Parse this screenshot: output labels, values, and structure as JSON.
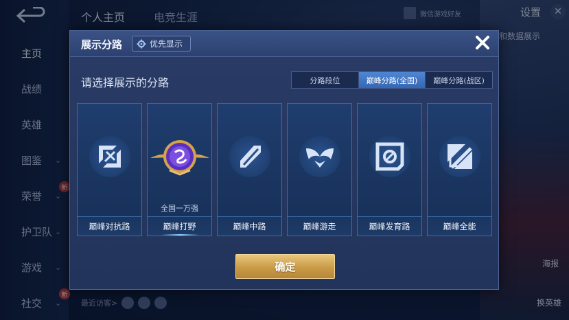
{
  "background": {
    "sidebar_items": [
      {
        "label": "主页",
        "active": true,
        "chevron": false,
        "new": false
      },
      {
        "label": "战绩",
        "active": false,
        "chevron": false,
        "new": false
      },
      {
        "label": "英雄",
        "active": false,
        "chevron": false,
        "new": false
      },
      {
        "label": "图鉴",
        "active": false,
        "chevron": true,
        "new": false
      },
      {
        "label": "荣誉",
        "active": false,
        "chevron": true,
        "new": true
      },
      {
        "label": "护卫队",
        "active": false,
        "chevron": true,
        "new": false
      },
      {
        "label": "游戏",
        "active": false,
        "chevron": true,
        "new": false
      },
      {
        "label": "社交",
        "active": false,
        "chevron": true,
        "new": true
      }
    ],
    "new_badge": "新",
    "top_tabs": [
      "个人主页",
      "电竞生涯"
    ],
    "settings_label": "设置",
    "profile_text": "微信游戏好友",
    "right_text": "定和数据展示",
    "recent_visitors": "最近访客>",
    "poster_label": "海报",
    "switch_hero_label": "换英雄"
  },
  "modal": {
    "title": "展示分路",
    "priority_button": "优先显示",
    "prompt": "请选择展示的分路",
    "segments": [
      {
        "label": "分路段位",
        "active": false
      },
      {
        "label": "巅峰分路(全国)",
        "active": true
      },
      {
        "label": "巅峰分路(战区)",
        "active": false
      }
    ],
    "cards": [
      {
        "label": "巅峰对抗路",
        "icon": "sword-crossed-icon",
        "caption": ""
      },
      {
        "label": "巅峰打野",
        "icon": "jungle-emblem-icon",
        "caption": "全国一万强"
      },
      {
        "label": "巅峰中路",
        "icon": "mid-lane-slash-icon",
        "caption": ""
      },
      {
        "label": "巅峰游走",
        "icon": "wings-icon",
        "caption": ""
      },
      {
        "label": "巅峰发育路",
        "icon": "target-square-icon",
        "caption": ""
      },
      {
        "label": "巅峰全能",
        "icon": "all-lanes-icon",
        "caption": ""
      }
    ],
    "confirm": "确定"
  },
  "colors": {
    "accent_blue": "#3f78c8",
    "gold": "#d4aa5c",
    "panel": "#22345b"
  }
}
